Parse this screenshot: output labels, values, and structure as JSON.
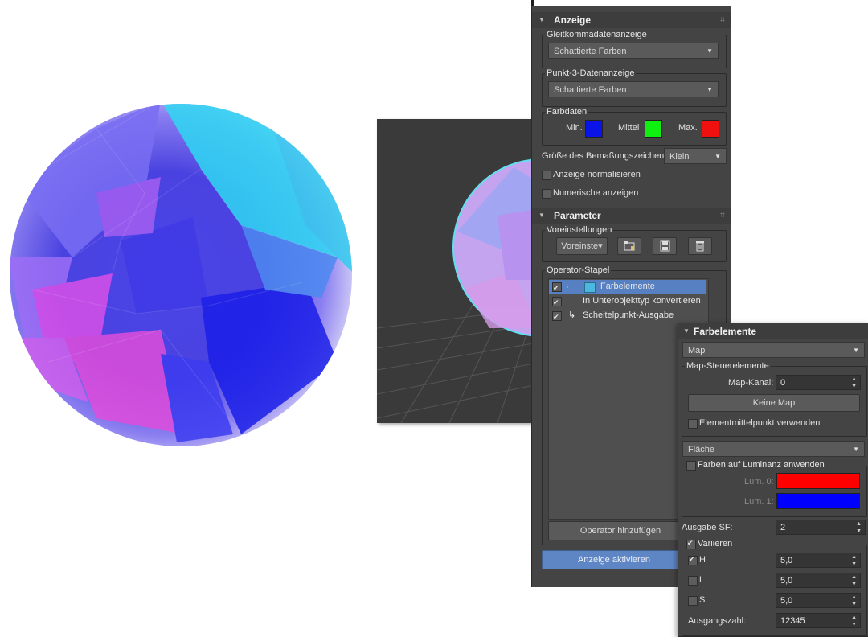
{
  "anzeige": {
    "title": "Anzeige",
    "gleitkomma_label": "Gleitkommadatenanzeige",
    "gleitkomma_value": "Schattierte Farben",
    "punkt3_label": "Punkt-3-Datenanzeige",
    "punkt3_value": "Schattierte Farben",
    "farbdaten_label": "Farbdaten",
    "min_label": "Min.",
    "mittel_label": "Mittel",
    "max_label": "Max.",
    "min_color": "#0a14e6",
    "mittel_color": "#10f010",
    "max_color": "#f01010",
    "groesse_label": "Größe des Bemaßungszeichens",
    "groesse_value": "Klein",
    "normalisieren_label": "Anzeige normalisieren",
    "numerisch_label": "Numerische anzeigen"
  },
  "parameter": {
    "title": "Parameter",
    "voreinstellungen_label": "Voreinstellungen",
    "voreinste_button": "Voreinste▾",
    "operator_stapel_label": "Operator-Stapel",
    "stack": [
      {
        "label": "Farbelemente",
        "checked": true
      },
      {
        "label": "In Unterobjekttyp konvertieren",
        "checked": true
      },
      {
        "label": "Scheitelpunkt-Ausgabe",
        "checked": true
      }
    ],
    "add_operator_button": "Operator hinzufügen",
    "activate_button": "Anzeige aktivieren"
  },
  "farbelemente": {
    "title": "Farbelemente",
    "mode_value": "Map",
    "map_group_label": "Map-Steuerelemente",
    "map_kanal_label": "Map-Kanal:",
    "map_kanal_value": "0",
    "keine_map_button": "Keine Map",
    "elementmittel_label": "Elementmittelpunkt verwenden",
    "flaeche_value": "Fläche",
    "luminanz_label": "Farben auf Luminanz anwenden",
    "lum0_label": "Lum. 0:",
    "lum1_label": "Lum. 1:",
    "lum0_color": "#ff0000",
    "lum1_color": "#0000ff",
    "ausgabe_label": "Ausgabe SF:",
    "ausgabe_value": "2",
    "variieren_label": "Variieren",
    "h_label": "H",
    "h_value": "5,0",
    "l_label": "L",
    "l_value": "5,0",
    "s_label": "S",
    "s_value": "5,0",
    "ausgangszahl_label": "Ausgangszahl:",
    "ausgangszahl_value": "12345"
  }
}
